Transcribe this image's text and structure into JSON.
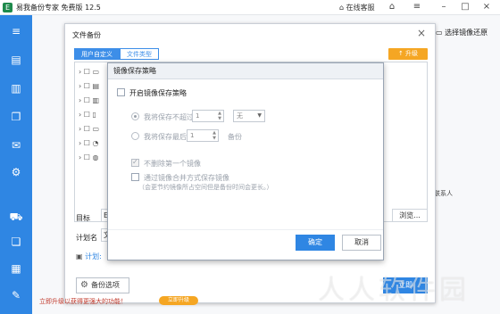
{
  "app": {
    "title": "易我备份专家 免费版 12.5",
    "online_service": "在线客服",
    "restore_link": "选择镜像还原",
    "contact_text": "联系人"
  },
  "backup_window": {
    "title": "文件备份",
    "tabs": [
      "用户自定义",
      "文件类型"
    ],
    "upgrade_label": "升级",
    "target_label": "目标",
    "target_value": "E",
    "browse_label": "浏览...",
    "plan_label": "计划名",
    "plan_value": "文",
    "schedule_label": "计划:",
    "options_label": "备份选项",
    "start_label": "立即"
  },
  "promo": {
    "text": "立即升级以获得更强大的功能！",
    "badge": "立即升级"
  },
  "dialog": {
    "title": "镜像保存策略",
    "enable_label": "开启镜像保存策略",
    "keep_not_exceed_label": "我将保存不超过",
    "keep_not_exceed_value": "1",
    "keep_unit": "无",
    "keep_last_label": "我将保存最后",
    "keep_last_value": "1",
    "keep_last_unit": "备份",
    "no_delete_first_label": "不删除第一个镜像",
    "merge_label": "通过镜像合并方式保存镜像",
    "merge_note": "（会更节约镜像所占空间但是备份时间会更长。）",
    "ok_label": "确定",
    "cancel_label": "取消"
  },
  "watermark": "人人软件园"
}
